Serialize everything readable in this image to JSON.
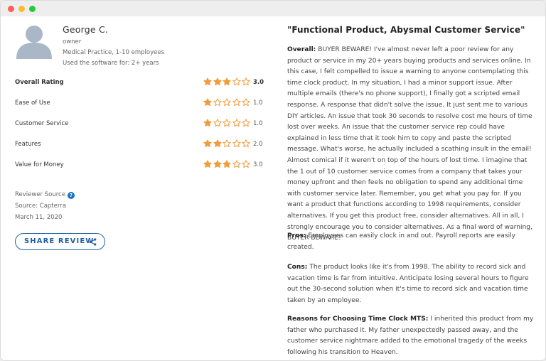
{
  "window": {
    "controls": [
      "close",
      "minimize",
      "maximize"
    ]
  },
  "reviewer": {
    "name": "George C.",
    "role": "owner",
    "company": "Medical Practice, 1-10 employees",
    "usage": "Used the software for: 2+ years"
  },
  "ratings": [
    {
      "label": "Overall Rating",
      "value": "3.0",
      "stars": 3
    },
    {
      "label": "Ease of Use",
      "value": "1.0",
      "stars": 1
    },
    {
      "label": "Customer Service",
      "value": "1.0",
      "stars": 1
    },
    {
      "label": "Features",
      "value": "2.0",
      "stars": 2
    },
    {
      "label": "Value for Money",
      "value": "3.0",
      "stars": 3
    }
  ],
  "source": {
    "reviewer_source_label": "Reviewer Source",
    "source_text": "Source: Capterra",
    "date": "March 11, 2020"
  },
  "share_button": {
    "label": "SHARE REVIEW",
    "icon": "share-icon"
  },
  "review": {
    "title": "\"Functional Product, Abysmal Customer Service\"",
    "overall_label": "Overall:",
    "overall_text": "BUYER BEWARE! I've almost never left a poor review for any product or service in my 20+ years buying products and services online. In this case, I felt compelled to issue a warning to anyone contemplating this time clock product. In my situation, I had a minor support issue. After multiple emails (there's no phone support), I finally got a scripted email response. A response that didn't solve the issue. It just sent me to various DIY articles. An issue that took 30 seconds to resolve cost me hours of time lost over weeks. An issue that the customer service rep could have explained in less time that it took him to copy and paste the scripted message. What's worse, he actually included a scathing insult in the email! Almost comical if it weren't on top of the hours of lost time. I imagine that the 1 out of 10 customer service comes from a company that takes your money upfront and then feels no obligation to spend any additional time with customer service later. Remember, you get what you pay for. If you want a product that functions according to 1998 requirements, consider alternatives. If you get this product free, consider alternatives. All in all, I strongly encourage you to consider alternatives. As a final word of warning, BUYER BEWARE!",
    "pros_label": "Pros:",
    "pros_text": "Employees can easily clock in and out. Payroll reports are easily created.",
    "cons_label": "Cons:",
    "cons_text": "The product looks like it's from 1998. The ability to record sick and vacation time is far from intuitive. Anticipate losing several hours to figure out the 30-second solution when it's time to record sick and vacation time taken by an employee.",
    "reasons_label": "Reasons for Choosing Time Clock MTS:",
    "reasons_text": "I inherited this product from my father who purchased it. My father unexpectedly passed away, and the customer service nightmare added to the emotional tragedy of the weeks following his transition to Heaven."
  },
  "colors": {
    "star_filled": "#f29b38",
    "star_empty_stroke": "#f29b38",
    "accent": "#1f5fa8",
    "avatar": "#a9b7c6"
  }
}
